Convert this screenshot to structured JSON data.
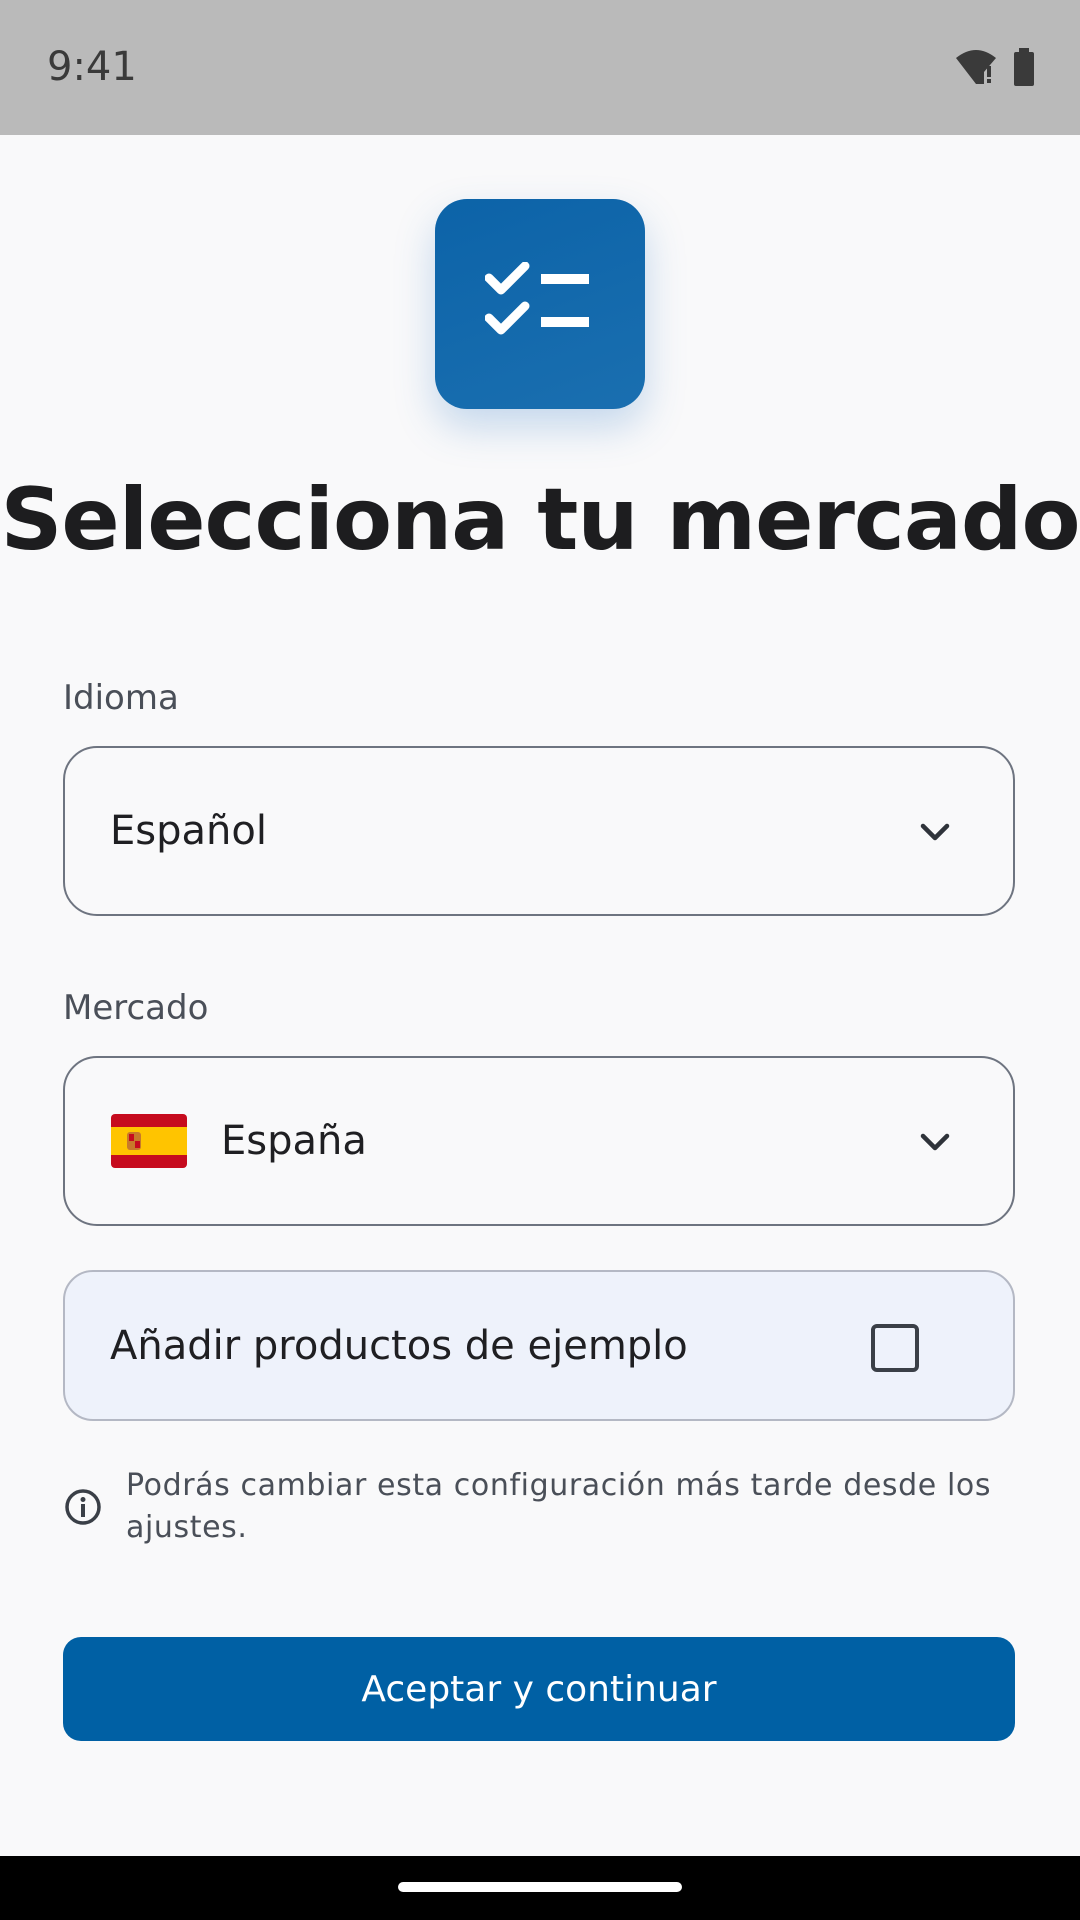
{
  "status_bar": {
    "time": "9:41",
    "icons": [
      "wifi-alert-icon",
      "battery-icon"
    ]
  },
  "app_icon": {
    "icon": "checklist-icon",
    "colors": {
      "background": "#0c63a8",
      "foreground": "#ffffff"
    }
  },
  "title": "Selecciona tu mercado",
  "language_field": {
    "label": "Idioma",
    "value": "Español"
  },
  "market_field": {
    "label": "Mercado",
    "value": "España",
    "flag_icon": "spain-flag-icon"
  },
  "sample_products": {
    "label": "Añadir productos de ejemplo",
    "checked": false
  },
  "info": {
    "text": "Podrás cambiar esta configuración más tarde desde los ajustes."
  },
  "primary_button": {
    "label": "Aceptar y continuar",
    "color": "#0060a4"
  }
}
